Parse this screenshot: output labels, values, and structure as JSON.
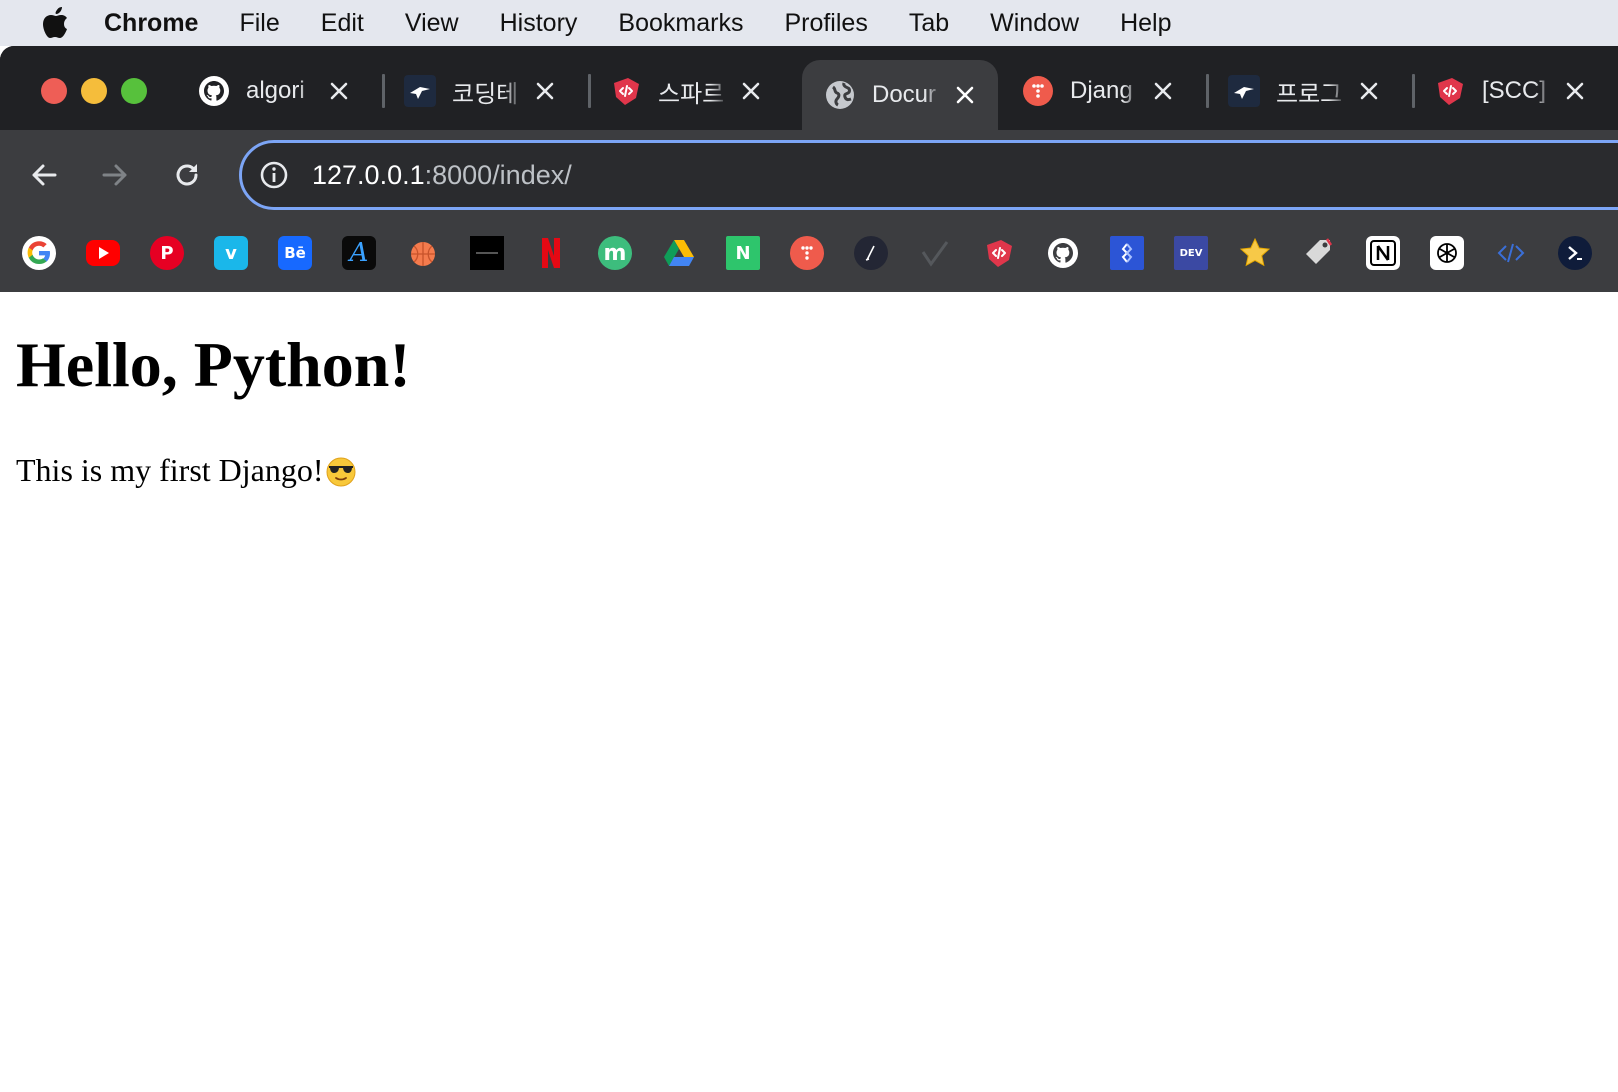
{
  "menubar": {
    "app": "Chrome",
    "items": [
      "File",
      "Edit",
      "View",
      "History",
      "Bookmarks",
      "Profiles",
      "Tab",
      "Window",
      "Help"
    ]
  },
  "tabs": [
    {
      "title": "algori",
      "icon": "github-icon",
      "active": false
    },
    {
      "title": "코딩테",
      "icon": "programmers-icon",
      "active": false
    },
    {
      "title": "스파르",
      "icon": "sparta-icon",
      "active": false
    },
    {
      "title": "Docur",
      "icon": "globe-icon",
      "active": true
    },
    {
      "title": "Djang",
      "icon": "dots-red-icon",
      "active": false
    },
    {
      "title": "프로그",
      "icon": "programmers-icon",
      "active": false
    },
    {
      "title": "[SCC]",
      "icon": "sparta-icon",
      "active": false
    }
  ],
  "omnibox": {
    "host": "127.0.0.1",
    "path": ":8000/index/"
  },
  "bookmarks": [
    "google-icon",
    "youtube-icon",
    "pinterest-icon",
    "vimeo-icon",
    "behance-icon",
    "script-a-icon",
    "basketball-icon",
    "black-box-icon",
    "netflix-icon",
    "m-circle-icon",
    "google-drive-icon",
    "n-green-icon",
    "dots-red-icon",
    "pen-circle-icon",
    "check-icon",
    "sparta-icon",
    "github-icon",
    "blue-gem-icon",
    "dev-icon",
    "star-icon",
    "tag-icon",
    "notion-icon",
    "openai-icon",
    "code-brackets-icon",
    "terminal-icon"
  ],
  "page": {
    "heading": "Hello, Python!",
    "paragraph": "This is my first Django!"
  },
  "colors": {
    "tabstrip": "#202124",
    "toolbar": "#3c3d40",
    "omnibox_border": "#7ca5f6",
    "menubar": "#e4e7ee"
  }
}
